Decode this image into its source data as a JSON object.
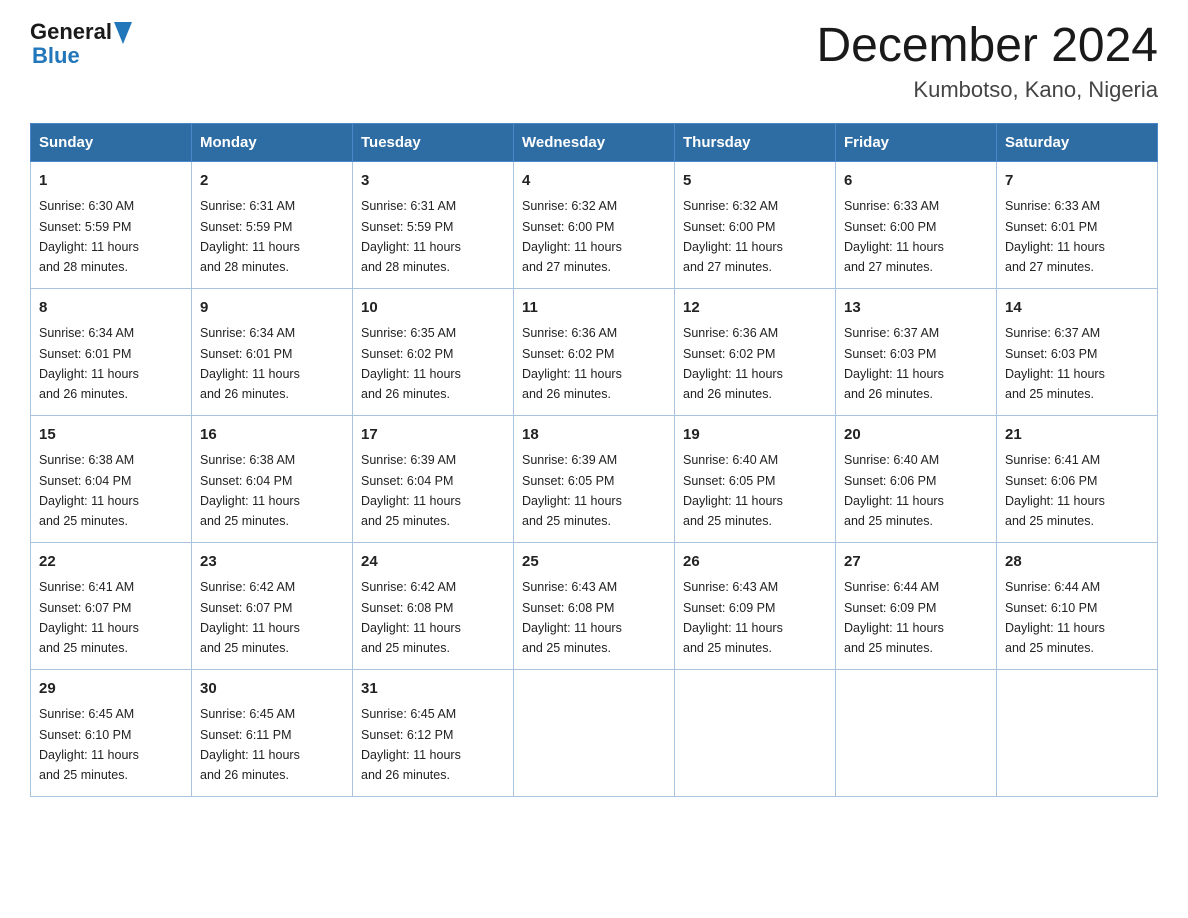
{
  "header": {
    "logo": {
      "general": "General",
      "blue": "Blue"
    },
    "title": "December 2024",
    "location": "Kumbotso, Kano, Nigeria"
  },
  "days_of_week": [
    "Sunday",
    "Monday",
    "Tuesday",
    "Wednesday",
    "Thursday",
    "Friday",
    "Saturday"
  ],
  "weeks": [
    [
      {
        "day": "1",
        "sunrise": "6:30 AM",
        "sunset": "5:59 PM",
        "daylight": "11 hours and 28 minutes."
      },
      {
        "day": "2",
        "sunrise": "6:31 AM",
        "sunset": "5:59 PM",
        "daylight": "11 hours and 28 minutes."
      },
      {
        "day": "3",
        "sunrise": "6:31 AM",
        "sunset": "5:59 PM",
        "daylight": "11 hours and 28 minutes."
      },
      {
        "day": "4",
        "sunrise": "6:32 AM",
        "sunset": "6:00 PM",
        "daylight": "11 hours and 27 minutes."
      },
      {
        "day": "5",
        "sunrise": "6:32 AM",
        "sunset": "6:00 PM",
        "daylight": "11 hours and 27 minutes."
      },
      {
        "day": "6",
        "sunrise": "6:33 AM",
        "sunset": "6:00 PM",
        "daylight": "11 hours and 27 minutes."
      },
      {
        "day": "7",
        "sunrise": "6:33 AM",
        "sunset": "6:01 PM",
        "daylight": "11 hours and 27 minutes."
      }
    ],
    [
      {
        "day": "8",
        "sunrise": "6:34 AM",
        "sunset": "6:01 PM",
        "daylight": "11 hours and 26 minutes."
      },
      {
        "day": "9",
        "sunrise": "6:34 AM",
        "sunset": "6:01 PM",
        "daylight": "11 hours and 26 minutes."
      },
      {
        "day": "10",
        "sunrise": "6:35 AM",
        "sunset": "6:02 PM",
        "daylight": "11 hours and 26 minutes."
      },
      {
        "day": "11",
        "sunrise": "6:36 AM",
        "sunset": "6:02 PM",
        "daylight": "11 hours and 26 minutes."
      },
      {
        "day": "12",
        "sunrise": "6:36 AM",
        "sunset": "6:02 PM",
        "daylight": "11 hours and 26 minutes."
      },
      {
        "day": "13",
        "sunrise": "6:37 AM",
        "sunset": "6:03 PM",
        "daylight": "11 hours and 26 minutes."
      },
      {
        "day": "14",
        "sunrise": "6:37 AM",
        "sunset": "6:03 PM",
        "daylight": "11 hours and 25 minutes."
      }
    ],
    [
      {
        "day": "15",
        "sunrise": "6:38 AM",
        "sunset": "6:04 PM",
        "daylight": "11 hours and 25 minutes."
      },
      {
        "day": "16",
        "sunrise": "6:38 AM",
        "sunset": "6:04 PM",
        "daylight": "11 hours and 25 minutes."
      },
      {
        "day": "17",
        "sunrise": "6:39 AM",
        "sunset": "6:04 PM",
        "daylight": "11 hours and 25 minutes."
      },
      {
        "day": "18",
        "sunrise": "6:39 AM",
        "sunset": "6:05 PM",
        "daylight": "11 hours and 25 minutes."
      },
      {
        "day": "19",
        "sunrise": "6:40 AM",
        "sunset": "6:05 PM",
        "daylight": "11 hours and 25 minutes."
      },
      {
        "day": "20",
        "sunrise": "6:40 AM",
        "sunset": "6:06 PM",
        "daylight": "11 hours and 25 minutes."
      },
      {
        "day": "21",
        "sunrise": "6:41 AM",
        "sunset": "6:06 PM",
        "daylight": "11 hours and 25 minutes."
      }
    ],
    [
      {
        "day": "22",
        "sunrise": "6:41 AM",
        "sunset": "6:07 PM",
        "daylight": "11 hours and 25 minutes."
      },
      {
        "day": "23",
        "sunrise": "6:42 AM",
        "sunset": "6:07 PM",
        "daylight": "11 hours and 25 minutes."
      },
      {
        "day": "24",
        "sunrise": "6:42 AM",
        "sunset": "6:08 PM",
        "daylight": "11 hours and 25 minutes."
      },
      {
        "day": "25",
        "sunrise": "6:43 AM",
        "sunset": "6:08 PM",
        "daylight": "11 hours and 25 minutes."
      },
      {
        "day": "26",
        "sunrise": "6:43 AM",
        "sunset": "6:09 PM",
        "daylight": "11 hours and 25 minutes."
      },
      {
        "day": "27",
        "sunrise": "6:44 AM",
        "sunset": "6:09 PM",
        "daylight": "11 hours and 25 minutes."
      },
      {
        "day": "28",
        "sunrise": "6:44 AM",
        "sunset": "6:10 PM",
        "daylight": "11 hours and 25 minutes."
      }
    ],
    [
      {
        "day": "29",
        "sunrise": "6:45 AM",
        "sunset": "6:10 PM",
        "daylight": "11 hours and 25 minutes."
      },
      {
        "day": "30",
        "sunrise": "6:45 AM",
        "sunset": "6:11 PM",
        "daylight": "11 hours and 26 minutes."
      },
      {
        "day": "31",
        "sunrise": "6:45 AM",
        "sunset": "6:12 PM",
        "daylight": "11 hours and 26 minutes."
      },
      null,
      null,
      null,
      null
    ]
  ],
  "labels": {
    "sunrise": "Sunrise:",
    "sunset": "Sunset:",
    "daylight": "Daylight:"
  }
}
